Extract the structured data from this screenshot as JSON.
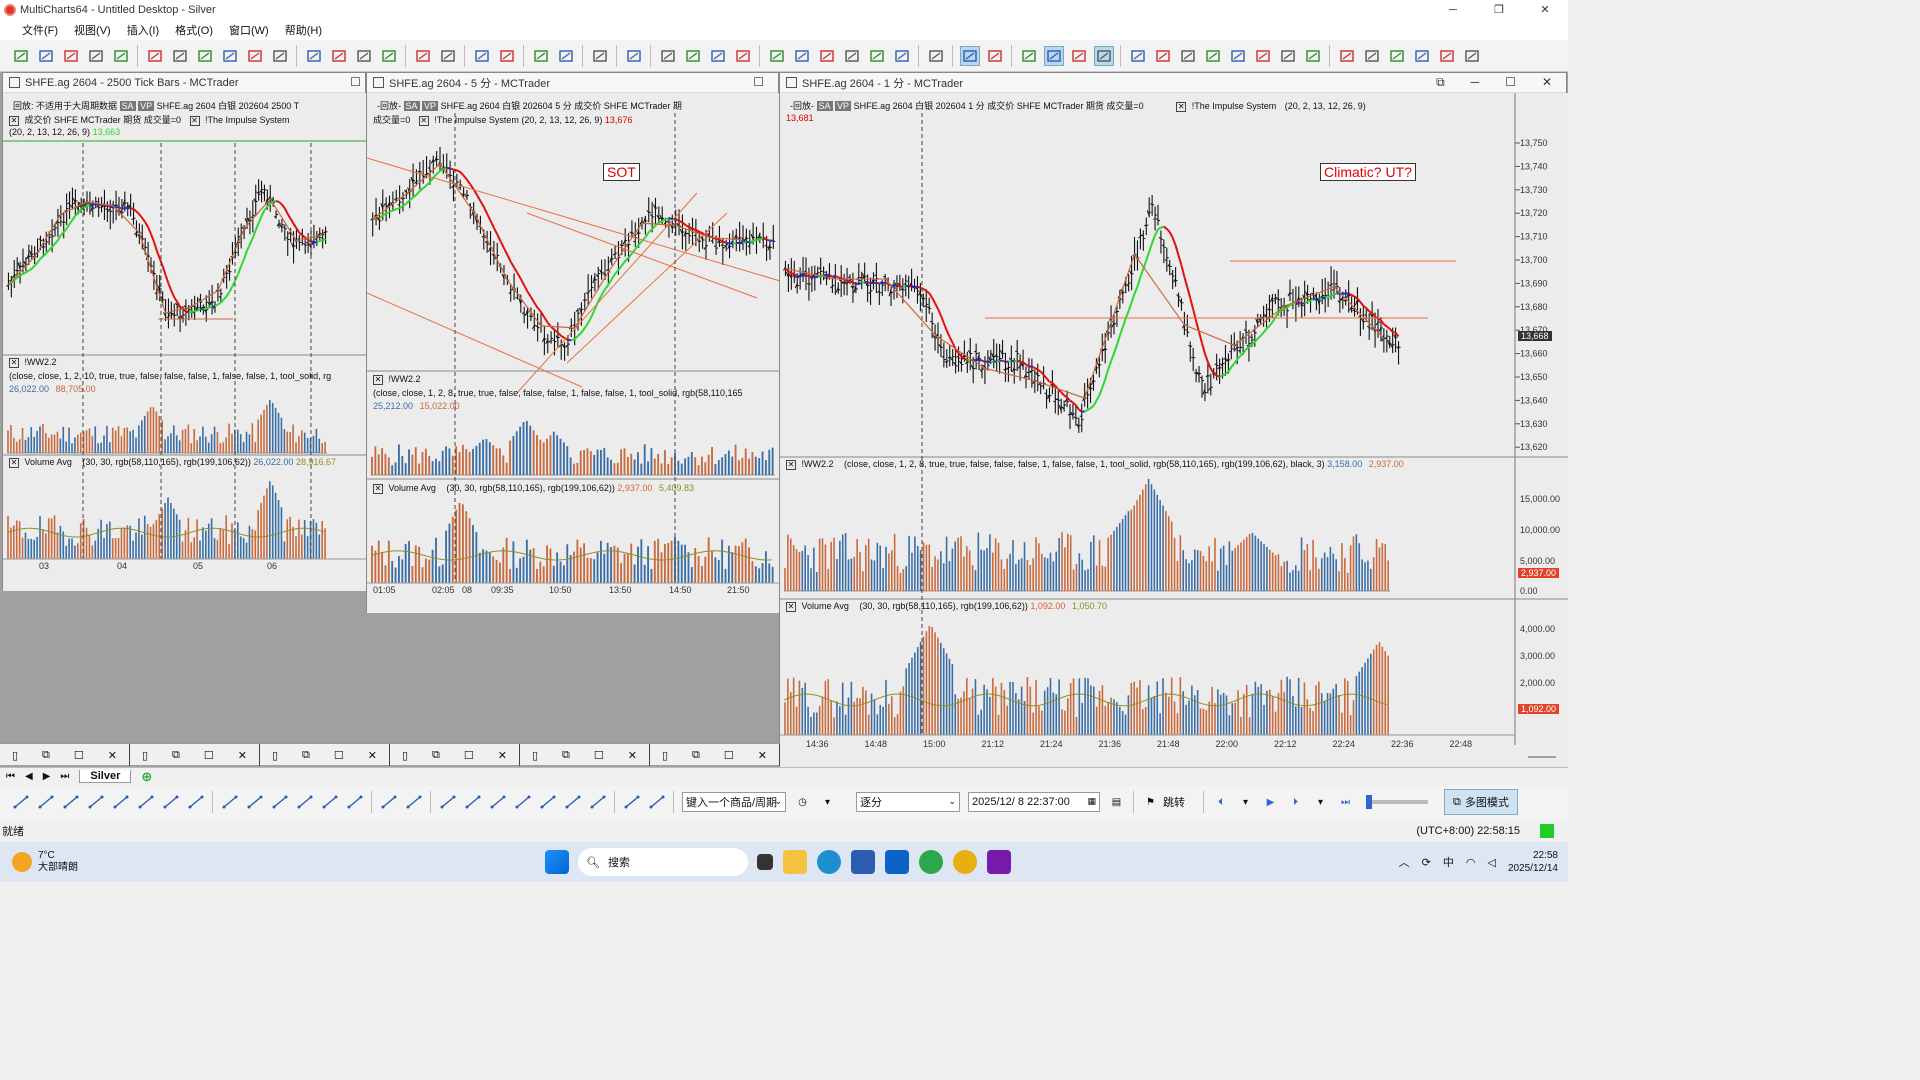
{
  "app": {
    "title": "MultiCharts64 - Untitled Desktop - Silver"
  },
  "menu": [
    "文件(F)",
    "视图(V)",
    "插入(I)",
    "格式(O)",
    "窗口(W)",
    "帮助(H)"
  ],
  "colors": {
    "up": "#3a6ea5",
    "down": "#c76a3e",
    "avg": "#8f8f25",
    "accent_red": "#e00000",
    "trend_red": "#e01010",
    "trend_blue": "#1a2fd6",
    "trend_green": "#2ed82e"
  },
  "chart1": {
    "title": "SHFE.ag 2604 - 2500 Tick Bars - MCTrader",
    "line1": "回放: 不适用于大周期数据",
    "badge_sa": "SA",
    "badge_vp": "VP",
    "symbol": "SHFE.ag 2604",
    "name": "白银 202604",
    "interval": "2500 T",
    "line2a": "成交价",
    "exch": "SHFE MCTrader 期货 成交量=0",
    "impulse": "!The Impulse System",
    "params": "(20, 2, 13, 12, 26, 9)",
    "last": "13,663",
    "ww_title": "!WW2.2",
    "ww_params": "(close, close, 1, 2, 10, true, true, false, false, false, 1, false, false, 1, tool_solid, rg",
    "ww_v1": "26,022.00",
    "ww_v2": "88,705.00",
    "vol_title": "Volume Avg",
    "vol_params": "(30, 30, rgb(58,110,165), rgb(199,106,62))",
    "vol_v1": "26,022.00",
    "vol_v2": "28,916.67",
    "xlabels": [
      "03",
      "04",
      "05",
      "06"
    ]
  },
  "chart2": {
    "title": "SHFE.ag 2604 - 5 分 - MCTrader",
    "line1": "-回放-",
    "badge_sa": "SA",
    "badge_vp": "VP",
    "symbol": "SHFE.ag 2604",
    "name": "白银 202604",
    "interval": "5 分",
    "exch": "成交价 SHFE MCTrader 期",
    "line2": "成交量=0",
    "impulse": "!The Impulse System",
    "params": "(20, 2, 13, 12, 26, 9)",
    "last": "13,676",
    "annotation": "SOT",
    "ww_title": "!WW2.2",
    "ww_params": "(close, close, 1, 2, 8, true, true, false, false, false, 1, false, false, 1, tool_solid, rgb(58,110,165",
    "ww_v1": "25,212.00",
    "ww_v2": "15,022.00",
    "vol_title": "Volume Avg",
    "vol_params": "(30, 30, rgb(58,110,165), rgb(199,106,62))",
    "vol_v1": "2,937.00",
    "vol_v2": "5,409.83",
    "xlabels": [
      "01:05",
      "02:05",
      "08",
      "09:35",
      "10:50",
      "13:50",
      "14:50",
      "21:50"
    ]
  },
  "chart3": {
    "title": "SHFE.ag 2604 - 1 分 - MCTrader",
    "line1": "-回放-",
    "badge_sa": "SA",
    "badge_vp": "VP",
    "symbol": "SHFE.ag 2604",
    "name": "白银 202604",
    "interval": "1 分",
    "exch": "成交价 SHFE MCTrader 期货 成交量=0",
    "impulse": "!The Impulse System",
    "params": "(20, 2, 13, 12, 26, 9)",
    "last": "13,681",
    "annotation": "Climatic? UT?",
    "price_badge": "13,668",
    "yticks": [
      "13,750",
      "13,740",
      "13,730",
      "13,720",
      "13,710",
      "13,700",
      "13,690",
      "13,680",
      "13,670",
      "13,660",
      "13,650",
      "13,640",
      "13,630",
      "13,620"
    ],
    "ww_title": "!WW2.2",
    "ww_params": "(close, close, 1, 2, 8, true, true, false, false, false, 1, false, false, 1, tool_solid, rgb(58,110,165), rgb(199,106,62), black, 3)",
    "ww_v1": "3,158.00",
    "ww_v2": "2,937.00",
    "ww_yticks": [
      "15,000.00",
      "10,000.00",
      "5,000.00",
      "0.00"
    ],
    "ww_badge": "2,937.00",
    "vol_title": "Volume Avg",
    "vol_params": "(30, 30, rgb(58,110,165), rgb(199,106,62))",
    "vol_v1": "1,092.00",
    "vol_v2": "1,050.70",
    "vol_yticks": [
      "4,000.00",
      "3,000.00",
      "2,000.00",
      "1,000.00"
    ],
    "vol_badge": "1,092.00",
    "xlabels": [
      "14:36",
      "14:48",
      "15:00",
      "21:12",
      "21:24",
      "21:36",
      "21:48",
      "22:00",
      "22:12",
      "22:24",
      "22:36",
      "22:48"
    ]
  },
  "sheet": {
    "name": "Silver"
  },
  "toolbar2": {
    "symbol_placeholder": "键入一个商品/周期",
    "mode": "逐分",
    "datetime": "2025/12/ 8 22:37:00",
    "jump": "跳转",
    "multi": "多图模式"
  },
  "status": {
    "left": "就绪",
    "time": "(UTC+8:00) 22:58:15"
  },
  "taskbar": {
    "weather_temp": "7°C",
    "weather_desc": "大部晴朗",
    "search": "搜索",
    "ime": "中",
    "clock_time": "22:58",
    "clock_date": "2025/12/14"
  }
}
